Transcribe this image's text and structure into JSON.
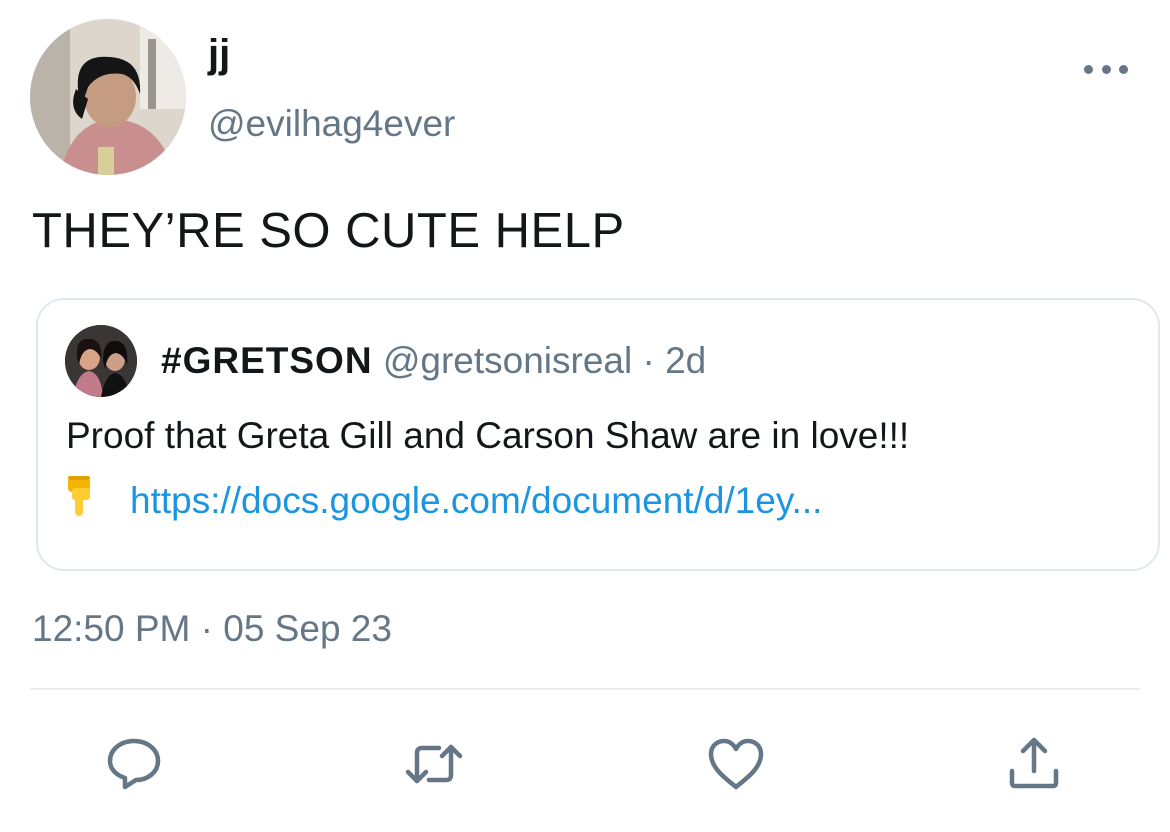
{
  "tweet": {
    "display_name": "jj",
    "handle": "@evilhag4ever",
    "text": "THEY’RE SO CUTE HELP",
    "timestamp": "12:50 PM · 05 Sep 23"
  },
  "quoted_tweet": {
    "display_name": "#GRETSON",
    "handle": "@gretsonisreal",
    "separator": "·",
    "age": "2d",
    "text": "Proof that Greta Gill and Carson Shaw are in love!!!",
    "emoji_icon": "pointing-down-hand",
    "link": "https://docs.google.com/document/d/1ey..."
  },
  "actions": {
    "icons": [
      "reply-icon",
      "retweet-icon",
      "like-icon",
      "share-icon"
    ]
  },
  "colors": {
    "text": "#14171a",
    "secondary": "#657786",
    "link": "#1b95e0",
    "border": "#e1e8ed"
  }
}
